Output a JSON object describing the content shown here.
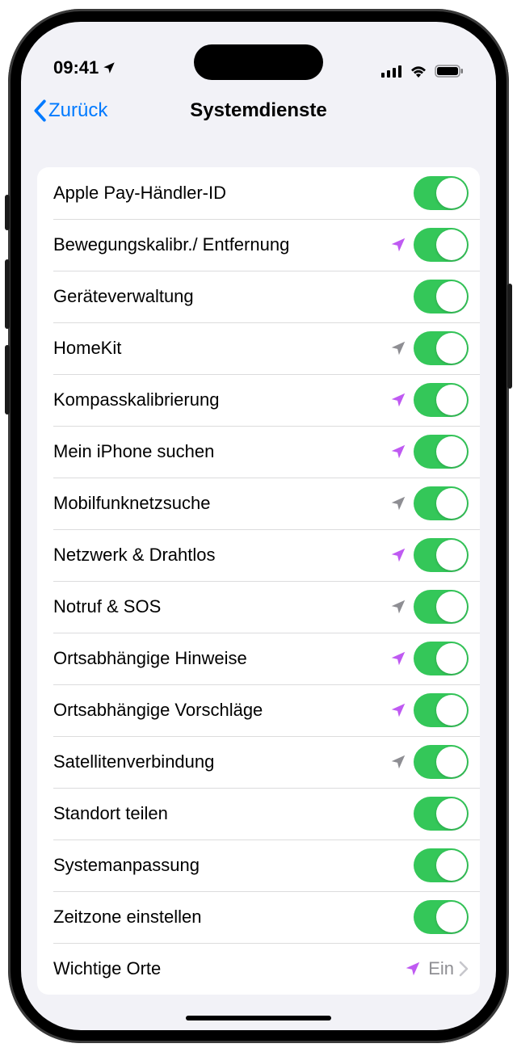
{
  "status": {
    "time": "09:41",
    "location_arrow": true
  },
  "nav": {
    "back_label": "Zurück",
    "title": "Systemdienste"
  },
  "items": [
    {
      "label": "Apple Pay-Händler-ID",
      "indicator": "none",
      "type": "toggle",
      "on": true
    },
    {
      "label": "Bewegungskalibr./ Entfernung",
      "indicator": "purple",
      "type": "toggle",
      "on": true
    },
    {
      "label": "Geräteverwaltung",
      "indicator": "none",
      "type": "toggle",
      "on": true
    },
    {
      "label": "HomeKit",
      "indicator": "gray",
      "type": "toggle",
      "on": true
    },
    {
      "label": "Kompasskalibrierung",
      "indicator": "purple",
      "type": "toggle",
      "on": true
    },
    {
      "label": "Mein iPhone suchen",
      "indicator": "purple",
      "type": "toggle",
      "on": true
    },
    {
      "label": "Mobilfunknetzsuche",
      "indicator": "gray",
      "type": "toggle",
      "on": true
    },
    {
      "label": "Netzwerk & Drahtlos",
      "indicator": "purple",
      "type": "toggle",
      "on": true
    },
    {
      "label": "Notruf & SOS",
      "indicator": "gray",
      "type": "toggle",
      "on": true
    },
    {
      "label": "Ortsabhängige Hinweise",
      "indicator": "purple",
      "type": "toggle",
      "on": true
    },
    {
      "label": "Ortsabhängige Vorschläge",
      "indicator": "purple",
      "type": "toggle",
      "on": true
    },
    {
      "label": "Satellitenverbindung",
      "indicator": "gray",
      "type": "toggle",
      "on": true
    },
    {
      "label": "Standort teilen",
      "indicator": "none",
      "type": "toggle",
      "on": true
    },
    {
      "label": "Systemanpassung",
      "indicator": "none",
      "type": "toggle",
      "on": true
    },
    {
      "label": "Zeitzone einstellen",
      "indicator": "none",
      "type": "toggle",
      "on": true
    },
    {
      "label": "Wichtige Orte",
      "indicator": "purple",
      "type": "link",
      "value": "Ein"
    }
  ],
  "colors": {
    "accent": "#007aff",
    "toggle_on": "#34c759",
    "indicator_purple": "#bf5af2",
    "indicator_gray": "#8e8e93"
  }
}
